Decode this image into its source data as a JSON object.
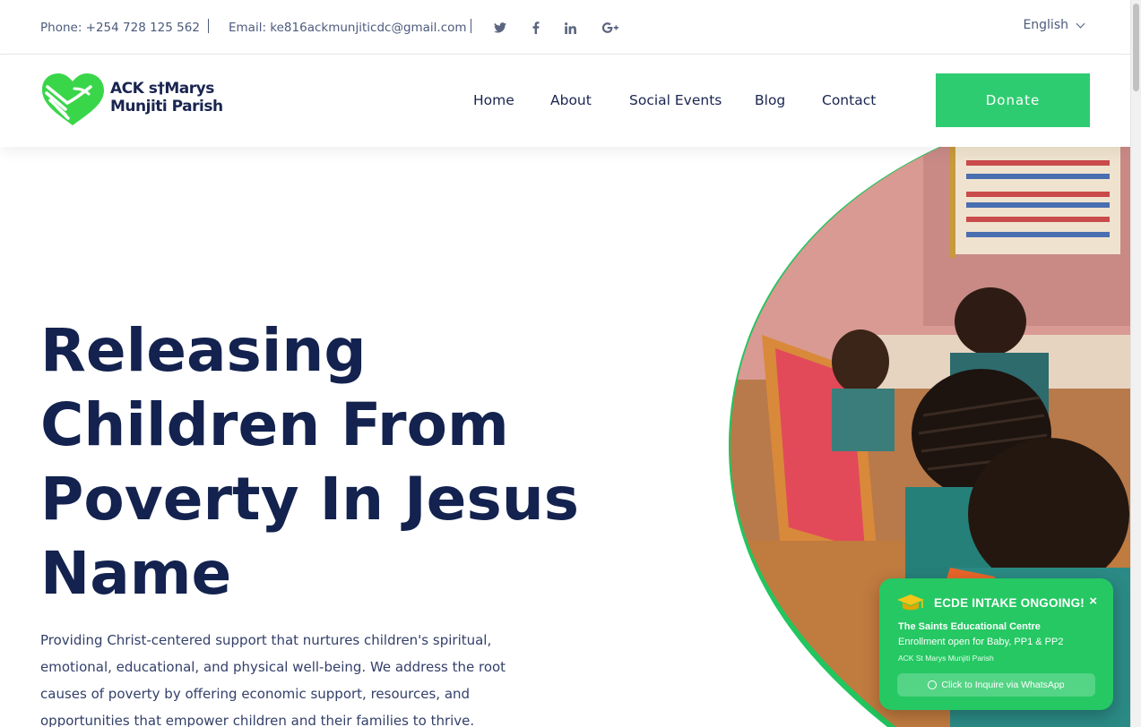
{
  "topbar": {
    "phone": "Phone: +254 728 125 562",
    "email": "Email: ke816ackmunjiticdc@gmail.com",
    "social": [
      {
        "name": "twitter-icon",
        "glyph": "🐦"
      },
      {
        "name": "facebook-icon",
        "glyph": "f"
      },
      {
        "name": "linkedin-icon",
        "glyph": "in"
      },
      {
        "name": "google-plus-icon",
        "glyph": "G+"
      }
    ],
    "language": "English"
  },
  "header": {
    "logo_line1": "ACK s†Marys",
    "logo_line2": "Munjiti Parish",
    "nav": [
      "Home",
      "About",
      "Social Events",
      "Blog",
      "Contact"
    ],
    "donate_label": "Donate"
  },
  "hero": {
    "title_lines": [
      "Releasing",
      "Children From",
      "Poverty In Jesus",
      "Name"
    ],
    "description": "Providing Christ-centered support that nurtures children's spiritual, emotional, educational, and physical well-being. We address the root causes of poverty by offering economic support, resources, and opportunities that empower children and their families to thrive."
  },
  "popup": {
    "title": "ECDE INTAKE ONGOING!",
    "close": "×",
    "line1": "The Saints Educational Centre",
    "line2": "Enrollment open for Baby, PP1 & PP2",
    "line3": "ACK St Marys Munjiti Parish",
    "button": "Click to Inquire via WhatsApp"
  },
  "colors": {
    "accent": "#2ecc71",
    "navy": "#13224e",
    "popup_green": "#25c863"
  }
}
